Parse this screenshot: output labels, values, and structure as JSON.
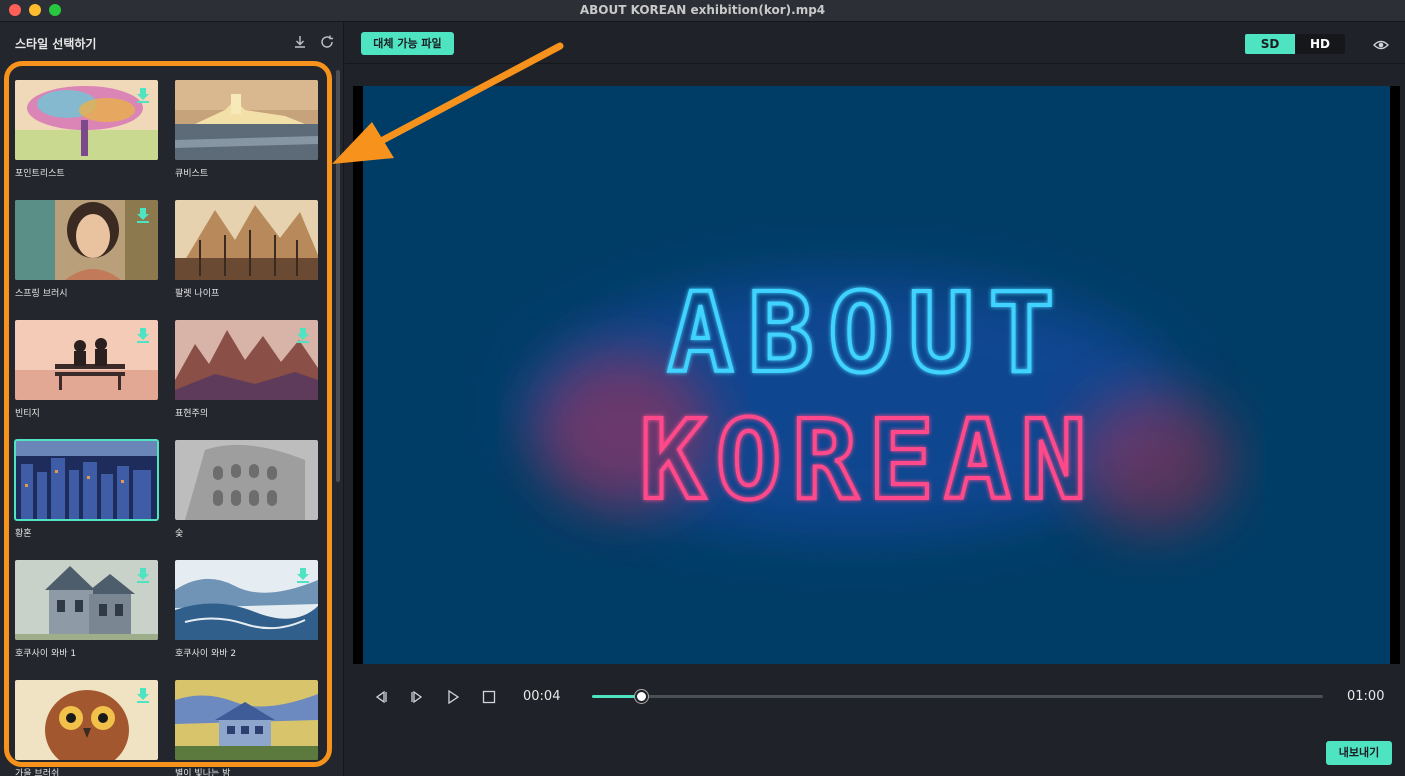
{
  "window": {
    "title": "ABOUT KOREAN exhibition(kor).mp4"
  },
  "style_panel": {
    "title": "스타일 선택하기",
    "icons": [
      "download-icon",
      "refresh-icon"
    ],
    "styles": [
      {
        "label": "포인트리스트",
        "thumbnail": "colorful-tree",
        "downloadable": true,
        "selected": false
      },
      {
        "label": "큐비스트",
        "thumbnail": "cubist-castle",
        "downloadable": false,
        "selected": false
      },
      {
        "label": "스프링 브러시",
        "thumbnail": "woman-portrait",
        "downloadable": true,
        "selected": false
      },
      {
        "label": "팔렛 나이프",
        "thumbnail": "autumn-trees",
        "downloadable": false,
        "selected": false
      },
      {
        "label": "빈티지",
        "thumbnail": "bench-couple",
        "downloadable": true,
        "selected": false
      },
      {
        "label": "표현주의",
        "thumbnail": "mountains",
        "downloadable": true,
        "selected": false
      },
      {
        "label": "황혼",
        "thumbnail": "city-night",
        "downloadable": false,
        "selected": true
      },
      {
        "label": "숯",
        "thumbnail": "colosseum-sketch",
        "downloadable": false,
        "selected": false
      },
      {
        "label": "호쿠사이 와바 1",
        "thumbnail": "victorian-house",
        "downloadable": true,
        "selected": false
      },
      {
        "label": "호쿠사이 와바 2",
        "thumbnail": "wave-landscape",
        "downloadable": true,
        "selected": false
      },
      {
        "label": "가을 브러쉬",
        "thumbnail": "owl",
        "downloadable": true,
        "selected": false
      },
      {
        "label": "별이 빛나는 밤",
        "thumbnail": "starry-house",
        "downloadable": false,
        "selected": false
      }
    ]
  },
  "toolbar": {
    "replace_button": "대체 가능 파일",
    "quality": {
      "options": [
        "SD",
        "HD"
      ],
      "selected": "SD"
    },
    "preview_icon": "eye-icon"
  },
  "video": {
    "line1": "ABOUT",
    "line2": "KOREAN"
  },
  "playback": {
    "current_time": "00:04",
    "total_time": "01:00",
    "progress": 0.067,
    "icons": [
      "prev-frame-icon",
      "next-frame-icon",
      "play-icon",
      "stop-icon"
    ]
  },
  "footer": {
    "export_button": "내보내기"
  },
  "colors": {
    "accent": "#4ee3c1",
    "annotation": "#f7931d",
    "video_bg": "#003d66"
  }
}
